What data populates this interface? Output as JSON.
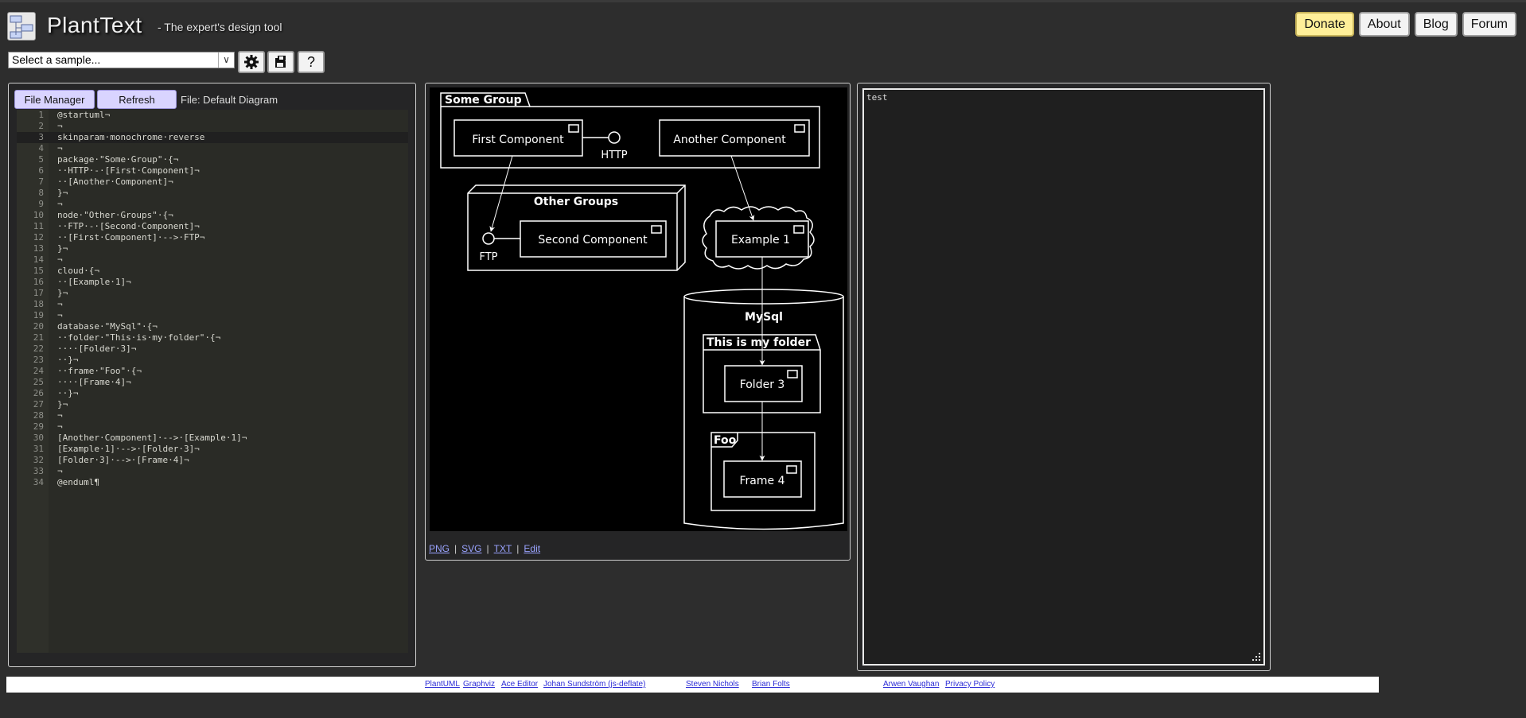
{
  "header": {
    "title": "PlantText",
    "tagline": "- The expert's design tool",
    "nav": [
      "Donate",
      "About",
      "Blog",
      "Forum"
    ]
  },
  "toolbar": {
    "sample_select": "Select a sample...",
    "settings_icon": "gear-icon",
    "save_icon": "save-icon",
    "help_label": "?"
  },
  "editor": {
    "file_manager_label": "File Manager",
    "refresh_label": "Refresh",
    "file_label": "File: Default Diagram",
    "lines": [
      "@startuml¬",
      "¬",
      "skinparam·monochrome·reverse",
      "¬",
      "package·\"Some·Group\"·{¬",
      "··HTTP·-·[First·Component]¬",
      "··[Another·Component]¬",
      "}¬",
      "¬",
      "node·\"Other·Groups\"·{¬",
      "··FTP·-·[Second·Component]¬",
      "··[First·Component]·-->·FTP¬",
      "}¬",
      "¬",
      "cloud·{¬",
      "··[Example·1]¬",
      "}¬",
      "¬",
      "¬",
      "database·\"MySql\"·{¬",
      "··folder·\"This·is·my·folder\"·{¬",
      "····[Folder·3]¬",
      "··}¬",
      "··frame·\"Foo\"·{¬",
      "····[Frame·4]¬",
      "··}¬",
      "}¬",
      "¬",
      "¬",
      "[Another·Component]·-->·[Example·1]¬",
      "[Example·1]·-->·[Folder·3]¬",
      "[Folder·3]·-->·[Frame·4]¬",
      "¬",
      "@enduml¶"
    ]
  },
  "diagram": {
    "packages": {
      "some_group": "Some Group",
      "other_groups": "Other Groups",
      "mysql": "MySql",
      "folder": "This is my folder",
      "foo": "Foo"
    },
    "components": {
      "first": "First Component",
      "another": "Another Component",
      "second": "Second Component",
      "example": "Example 1",
      "folder3": "Folder 3",
      "frame4": "Frame 4"
    },
    "interfaces": {
      "http": "HTTP",
      "ftp": "FTP"
    }
  },
  "export_links": [
    "PNG",
    "SVG",
    "TXT",
    "Edit"
  ],
  "output": {
    "text": "test"
  },
  "footer": {
    "links": [
      "PlantUML",
      "Graphviz",
      "Ace Editor",
      "Johan Sundström (js-deflate)",
      "Steven Nichols",
      "Brian Folts",
      "Arwen Vaughan",
      "Privacy Policy"
    ]
  }
}
